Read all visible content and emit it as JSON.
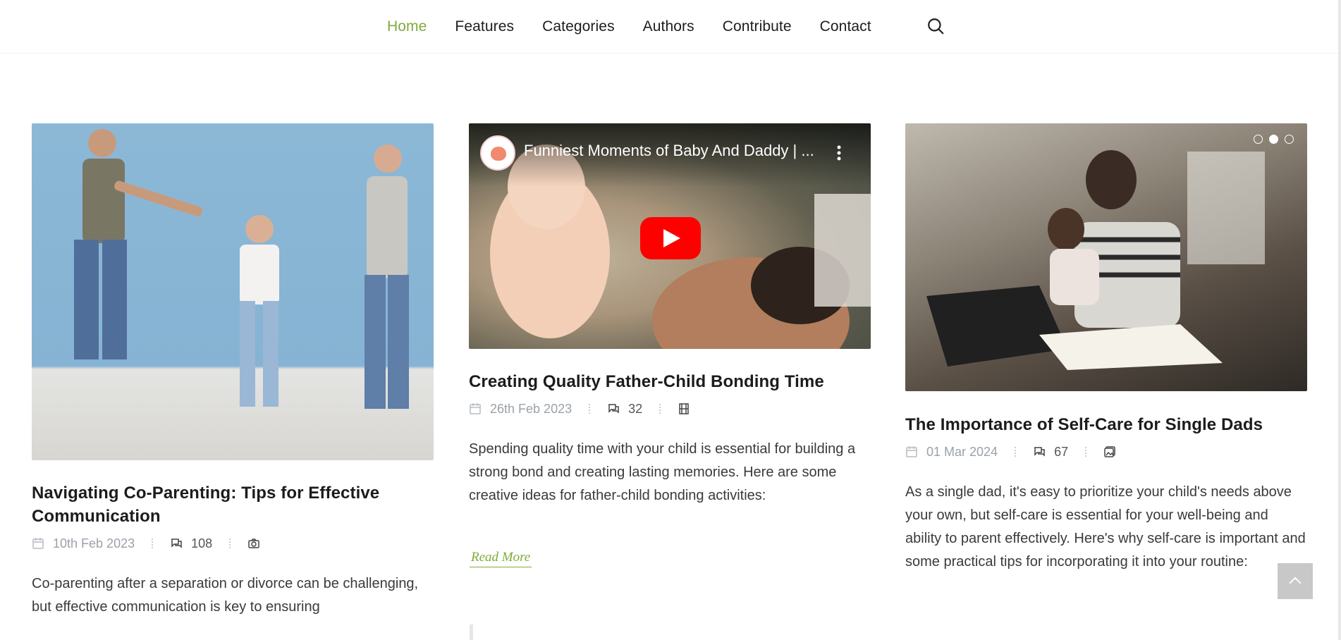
{
  "nav": {
    "items": [
      {
        "label": "Home",
        "active": true
      },
      {
        "label": "Features",
        "active": false
      },
      {
        "label": "Categories",
        "active": false
      },
      {
        "label": "Authors",
        "active": false
      },
      {
        "label": "Contribute",
        "active": false
      },
      {
        "label": "Contact",
        "active": false
      }
    ],
    "search_icon": "search-icon",
    "accent_color": "#7fab3c"
  },
  "posts": [
    {
      "title": "Navigating Co-Parenting: Tips for Effective Communication",
      "date": "10th Feb 2023",
      "comments": "108",
      "format_icon": "camera-icon",
      "excerpt": "Co-parenting after a separation or divorce can be challenging, but effective communication is key to ensuring"
    },
    {
      "video_title": "Funniest Moments of Baby And Daddy | ...",
      "channel_logo": "Cool Peachy",
      "title": "Creating Quality Father-Child Bonding Time",
      "date": "26th Feb 2023",
      "comments": "32",
      "format_icon": "film-icon",
      "excerpt": "Spending quality time with your child is essential for building a strong bond and creating lasting memories. Here are some creative ideas for father-child bonding activities:",
      "read_more": "Read More"
    },
    {
      "title": "The Importance of Self-Care for Single Dads",
      "date": "01 Mar 2024",
      "comments": "67",
      "format_icon": "gallery-icon",
      "slider_active_index": 1,
      "slider_count": 3,
      "excerpt": "As a single dad, it's easy to prioritize your child's needs above your own, but self-care is essential for your well-being and ability to parent effectively. Here's why self-care is important and some practical tips for incorporating it into your routine:"
    }
  ]
}
